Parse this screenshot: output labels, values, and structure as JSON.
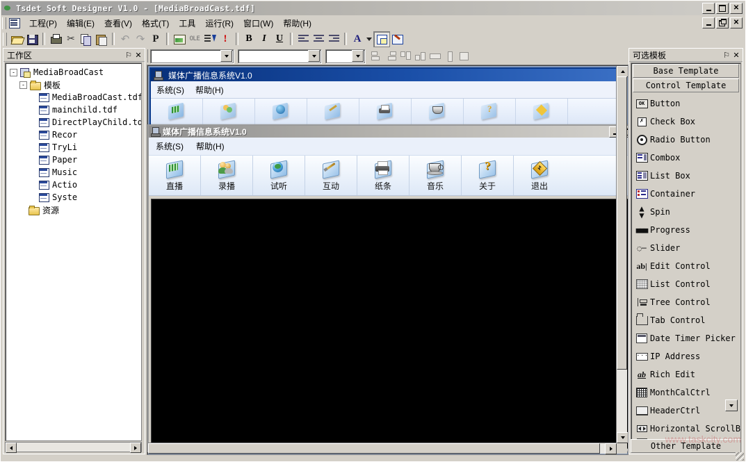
{
  "app": {
    "title": "Tsdet Soft Designer V1.0 - [MediaBroadCast.tdf]",
    "icon": "globe-icon"
  },
  "window_controls": {
    "minimize": "_",
    "maximize": "□",
    "restore": "❐",
    "close": "✕"
  },
  "menu": {
    "items": [
      {
        "label": "工程(P)",
        "name": "menu-project"
      },
      {
        "label": "编辑(E)",
        "name": "menu-edit"
      },
      {
        "label": "查看(V)",
        "name": "menu-view"
      },
      {
        "label": "格式(T)",
        "name": "menu-format"
      },
      {
        "label": "工具",
        "name": "menu-tools"
      },
      {
        "label": "运行(R)",
        "name": "menu-run"
      },
      {
        "label": "窗口(W)",
        "name": "menu-window"
      },
      {
        "label": "帮助(H)",
        "name": "menu-help"
      }
    ]
  },
  "toolbar": {
    "buttons": [
      {
        "name": "open-button",
        "icon": "folder-open-icon",
        "glyph": ""
      },
      {
        "name": "save-button",
        "icon": "floppy-save-icon",
        "glyph": ""
      },
      {
        "name": "print-button",
        "icon": "printer-icon",
        "glyph": ""
      },
      {
        "name": "cut-button",
        "icon": "scissors-icon",
        "glyph": "✂"
      },
      {
        "name": "copy-button",
        "icon": "copy-icon",
        "glyph": ""
      },
      {
        "name": "paste-button",
        "icon": "paste-icon",
        "glyph": ""
      },
      {
        "name": "undo-button",
        "icon": "undo-arrow-icon",
        "glyph": "↶"
      },
      {
        "name": "redo-button",
        "icon": "redo-arrow-icon",
        "glyph": "↷"
      },
      {
        "name": "paragraph-button",
        "icon": "pilcrow-icon",
        "glyph": "P"
      },
      {
        "name": "insert-image-button",
        "icon": "image-icon",
        "glyph": ""
      },
      {
        "name": "ole-button",
        "icon": "ole-icon",
        "glyph": "OLE"
      },
      {
        "name": "sort-button",
        "icon": "sort-descending-icon",
        "glyph": ""
      },
      {
        "name": "alert-button",
        "icon": "exclamation-icon",
        "glyph": "!"
      },
      {
        "name": "bold-button",
        "icon": "bold-icon",
        "glyph": "B"
      },
      {
        "name": "italic-button",
        "icon": "italic-icon",
        "glyph": "I"
      },
      {
        "name": "underline-button",
        "icon": "underline-icon",
        "glyph": "U"
      },
      {
        "name": "align-left-button",
        "icon": "align-left-icon",
        "glyph": ""
      },
      {
        "name": "align-center-button",
        "icon": "align-center-icon",
        "glyph": ""
      },
      {
        "name": "align-right-button",
        "icon": "align-right-icon",
        "glyph": ""
      },
      {
        "name": "font-color-button",
        "icon": "font-color-a-icon",
        "glyph": "A"
      },
      {
        "name": "font-color-dropdown",
        "icon": "chevron-down-icon",
        "glyph": ""
      },
      {
        "name": "properties-button",
        "icon": "property-grid-icon",
        "glyph": ""
      },
      {
        "name": "wizard-button",
        "icon": "wizard-wand-icon",
        "glyph": ""
      }
    ]
  },
  "toolbar2": {
    "combo1": {
      "value": "",
      "placeholder": ""
    },
    "combo2": {
      "value": "",
      "placeholder": ""
    },
    "combo3": {
      "value": "",
      "placeholder": ""
    },
    "align_buttons": [
      {
        "name": "align-lefts-button",
        "icon": "align-lefts-icon"
      },
      {
        "name": "align-rights-button",
        "icon": "align-rights-icon"
      },
      {
        "name": "align-tops-button",
        "icon": "align-tops-icon"
      },
      {
        "name": "align-bottoms-button",
        "icon": "align-bottoms-icon"
      },
      {
        "name": "make-same-width-button",
        "icon": "same-width-icon"
      },
      {
        "name": "make-same-height-button",
        "icon": "same-height-icon"
      },
      {
        "name": "make-same-size-button",
        "icon": "same-size-icon"
      }
    ]
  },
  "workspace": {
    "title": "工作区",
    "pin": "⚐",
    "close": "✕",
    "tree": [
      {
        "label": "MediaBroadCast",
        "icon": "project-icon",
        "depth": 0,
        "toggle": "-"
      },
      {
        "label": "模板",
        "icon": "folder-icon",
        "depth": 1,
        "toggle": "-"
      },
      {
        "label": "MediaBroadCast.tdf",
        "icon": "form-icon",
        "depth": 2,
        "toggle": ""
      },
      {
        "label": "mainchild.tdf",
        "icon": "form-icon",
        "depth": 2,
        "toggle": ""
      },
      {
        "label": "DirectPlayChild.td",
        "icon": "form-icon",
        "depth": 2,
        "toggle": ""
      },
      {
        "label": "Recor",
        "icon": "form-icon",
        "depth": 2,
        "toggle": ""
      },
      {
        "label": "TryLi",
        "icon": "form-icon",
        "depth": 2,
        "toggle": ""
      },
      {
        "label": "Paper",
        "icon": "form-icon",
        "depth": 2,
        "toggle": ""
      },
      {
        "label": "Music",
        "icon": "form-icon",
        "depth": 2,
        "toggle": ""
      },
      {
        "label": "Actio",
        "icon": "form-icon",
        "depth": 2,
        "toggle": ""
      },
      {
        "label": "Syste",
        "icon": "form-icon",
        "depth": 2,
        "toggle": ""
      },
      {
        "label": "资源",
        "icon": "folder-icon",
        "depth": 1,
        "toggle": ""
      }
    ]
  },
  "mdi": {
    "background_window": {
      "title": "媒体广播信息系统V1.0",
      "menu": [
        "系统(S)",
        "帮助(H)"
      ]
    },
    "active_window": {
      "title": "媒体广播信息系统V1.0",
      "menu": [
        "系统(S)",
        "帮助(H)"
      ],
      "toolbar": [
        {
          "label": "直播",
          "icon": "live-broadcast-icon"
        },
        {
          "label": "录播",
          "icon": "recorded-broadcast-icon"
        },
        {
          "label": "试听",
          "icon": "audition-icon"
        },
        {
          "label": "互动",
          "icon": "interaction-icon"
        },
        {
          "label": "纸条",
          "icon": "note-printer-icon"
        },
        {
          "label": "音乐",
          "icon": "music-coffee-icon"
        },
        {
          "label": "关于",
          "icon": "about-question-icon"
        },
        {
          "label": "退出",
          "icon": "exit-icon"
        }
      ],
      "canvas_color": "#000000"
    }
  },
  "templates": {
    "title": "可选模板",
    "pin": "⚐",
    "close": "✕",
    "base_template": "Base Template",
    "control_template": "Control Template",
    "other_template": "Other Template",
    "items": [
      {
        "label": "Button",
        "icon": "ok-button-icon"
      },
      {
        "label": "Check Box",
        "icon": "checkbox-icon"
      },
      {
        "label": "Radio Button",
        "icon": "radio-button-icon"
      },
      {
        "label": "Combox",
        "icon": "combobox-icon"
      },
      {
        "label": "List Box",
        "icon": "listbox-icon"
      },
      {
        "label": "Container",
        "icon": "container-icon"
      },
      {
        "label": "Spin",
        "icon": "spin-icon"
      },
      {
        "label": "Progress",
        "icon": "progress-icon"
      },
      {
        "label": "Slider",
        "icon": "slider-icon"
      },
      {
        "label": "Edit Control",
        "icon": "edit-control-icon"
      },
      {
        "label": "List Control",
        "icon": "list-control-icon"
      },
      {
        "label": "Tree Control",
        "icon": "tree-control-icon"
      },
      {
        "label": "Tab Control",
        "icon": "tab-control-icon"
      },
      {
        "label": "Date Timer Picker",
        "icon": "date-picker-icon"
      },
      {
        "label": "IP Address",
        "icon": "ip-address-icon"
      },
      {
        "label": "Rich Edit",
        "icon": "rich-edit-icon"
      },
      {
        "label": "MonthCalCtrl",
        "icon": "month-calendar-icon"
      },
      {
        "label": "HeaderCtrl",
        "icon": "header-control-icon"
      },
      {
        "label": "Horizontal ScrollBar",
        "icon": "horizontal-scrollbar-icon"
      }
    ]
  },
  "watermark": {
    "text": "www.taskcity.com"
  },
  "colors": {
    "window_face": "#d4d0c8",
    "active_caption": "#0a3a8c",
    "inactive_caption": "#9d9d9d",
    "mdi_client": "#8a9fc0",
    "canvas": "#000000"
  }
}
